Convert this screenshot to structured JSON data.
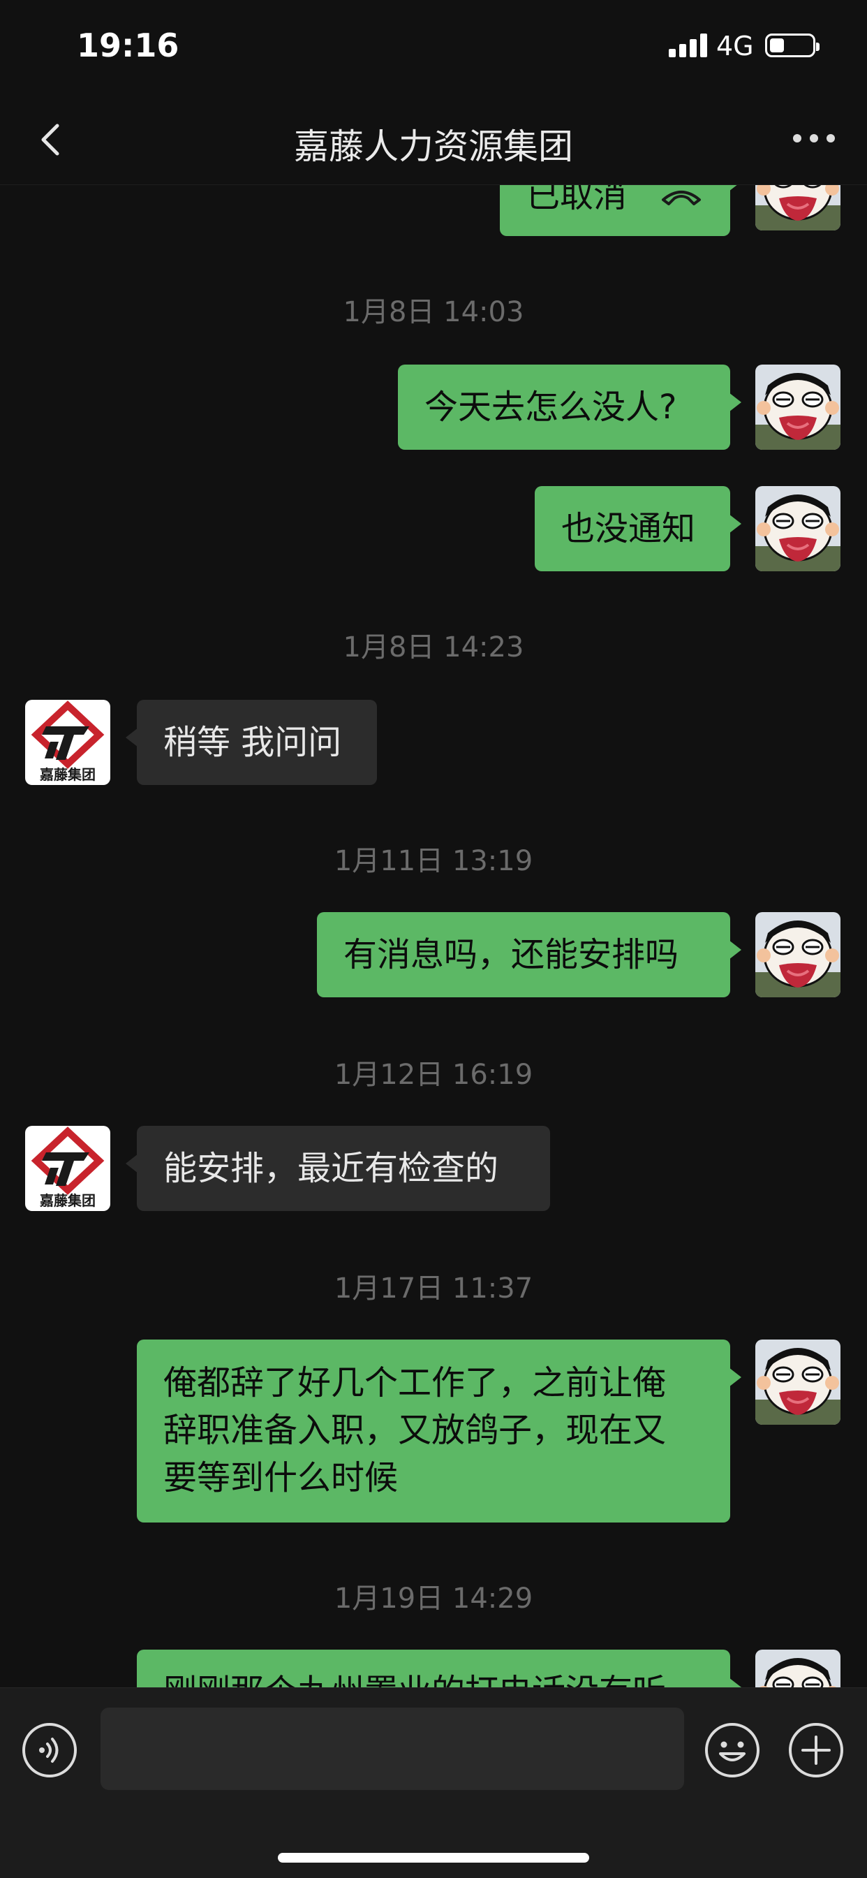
{
  "status_bar": {
    "time": "19:16",
    "network": "4G"
  },
  "header": {
    "title": "嘉藤人力资源集团",
    "back_icon": "chevron-left-icon",
    "more_icon": "ellipsis-icon"
  },
  "contact": {
    "avatar_text": "嘉藤集团"
  },
  "messages": [
    {
      "type": "call",
      "dir": "out",
      "text": "已取消",
      "icon": "phone-hangup-icon"
    },
    {
      "type": "timestamp",
      "text": "1月8日 14:03"
    },
    {
      "type": "text",
      "dir": "out",
      "text": "今天去怎么没人?"
    },
    {
      "type": "text",
      "dir": "out",
      "text": "也没通知"
    },
    {
      "type": "timestamp",
      "text": "1月8日 14:23"
    },
    {
      "type": "text",
      "dir": "in",
      "text": "稍等 我问问"
    },
    {
      "type": "timestamp",
      "text": "1月11日 13:19"
    },
    {
      "type": "text",
      "dir": "out",
      "text": "有消息吗，还能安排吗"
    },
    {
      "type": "timestamp",
      "text": "1月12日 16:19"
    },
    {
      "type": "text",
      "dir": "in",
      "text": "能安排，最近有检查的"
    },
    {
      "type": "timestamp",
      "text": "1月17日 11:37"
    },
    {
      "type": "text",
      "dir": "out",
      "lines": [
        "俺都辞了好几个工作了，之前让俺",
        "辞职准备入职，又放鸽子，现在又",
        "要等到什么时候"
      ]
    },
    {
      "type": "timestamp",
      "text": "1月19日 14:29"
    },
    {
      "type": "text",
      "dir": "out",
      "text": "刚刚那个九州置业的打电话没有听"
    }
  ],
  "input_bar": {
    "voice_icon": "voice-icon",
    "emoji_icon": "emoji-icon",
    "plus_icon": "plus-icon"
  },
  "colors": {
    "background": "#111111",
    "outgoing_bubble": "#5cb865",
    "incoming_bubble": "#2c2c2c",
    "timestamp": "#6b6b6b"
  }
}
